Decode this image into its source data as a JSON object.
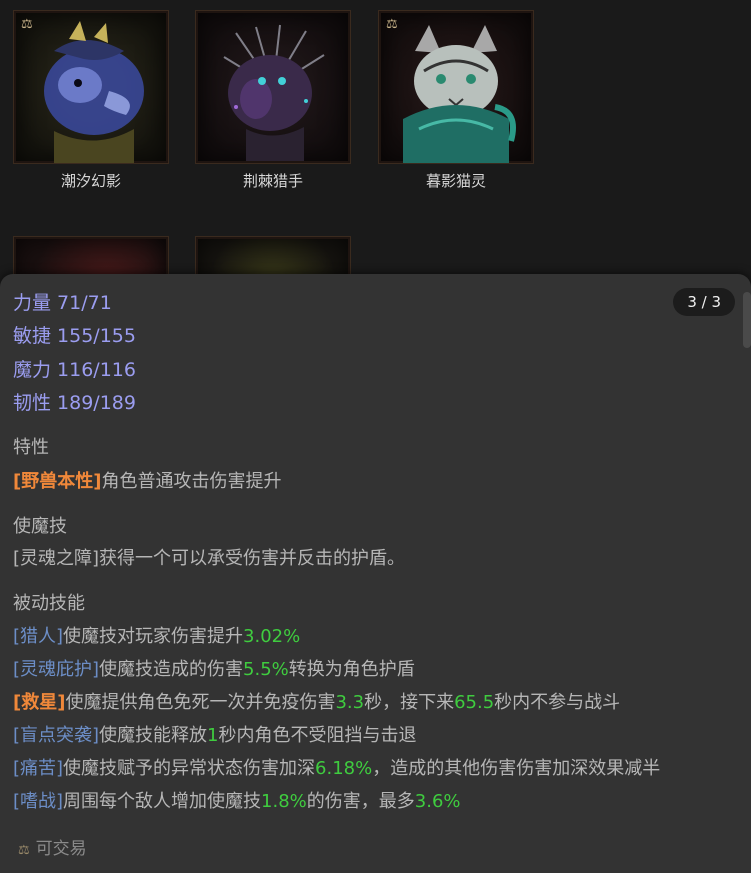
{
  "cards": [
    {
      "name": "潮汐幻影",
      "tradeable": true
    },
    {
      "name": "荆棘猎手",
      "tradeable": false
    },
    {
      "name": "暮影猫灵",
      "tradeable": true
    }
  ],
  "panel": {
    "page_indicator": "3 / 3",
    "stats": {
      "strength": "力量 71/71",
      "agility": "敏捷 155/155",
      "magic": "魔力 116/116",
      "toughness": "韧性 189/189"
    },
    "trait_title": "特性",
    "trait": {
      "tag": "[野兽本性]",
      "text": "角色普通攻击伤害提升"
    },
    "skill_title": "使魔技",
    "skill_text": "[灵魂之障]获得一个可以承受伤害并反击的护盾。",
    "passive_title": "被动技能",
    "passives": [
      {
        "tag": "[猎人]",
        "p1": "使魔技对玩家伤害提升",
        "n1": "3.02%",
        "p2": "",
        "n2": "",
        "p3": ""
      },
      {
        "tag": "[灵魂庇护]",
        "p1": "使魔技造成的伤害",
        "n1": "5.5%",
        "p2": "转换为角色护盾",
        "n2": "",
        "p3": ""
      },
      {
        "tag": "[救星]",
        "p1": "使魔提供角色免死一次并免疫伤害",
        "n1": "3.3",
        "p2": "秒，接下来",
        "n2": "65.5",
        "p3": "秒内不参与战斗"
      },
      {
        "tag": "[盲点突袭]",
        "p1": "使魔技能释放",
        "n1": "1",
        "p2": "秒内角色不受阻挡与击退",
        "n2": "",
        "p3": ""
      },
      {
        "tag": "[痛苦]",
        "p1": "使魔技赋予的异常状态伤害加深",
        "n1": "6.18%",
        "p2": "，造成的其他伤害伤害加深效果减半",
        "n2": "",
        "p3": ""
      },
      {
        "tag": "[嗜战]",
        "p1": "周围每个敌人增加使魔技",
        "n1": "1.8%",
        "p2": "的伤害，最多",
        "n2": "3.6%",
        "p3": ""
      }
    ],
    "footer": "可交易"
  },
  "icons": {
    "trade": "scales-icon"
  },
  "colors": {
    "stat": "#9b9df0",
    "tag_orange": "#f0883a",
    "tag_blue": "#6c8ec7",
    "number": "#3fcc3f",
    "panel_bg": "#333333"
  }
}
